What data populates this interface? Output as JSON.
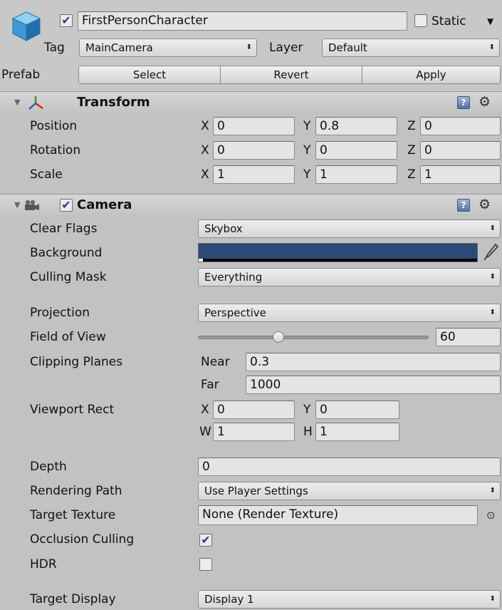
{
  "gameobject": {
    "name": "FirstPersonCharacter",
    "active": true,
    "static_label": "Static",
    "tag_label": "Tag",
    "tag_value": "MainCamera",
    "layer_label": "Layer",
    "layer_value": "Default",
    "prefab_label": "Prefab",
    "prefab_buttons": [
      "Select",
      "Revert",
      "Apply"
    ]
  },
  "transform": {
    "title": "Transform",
    "rows": [
      {
        "label": "Position",
        "x": "0",
        "y": "0.8",
        "z": "0"
      },
      {
        "label": "Rotation",
        "x": "0",
        "y": "0",
        "z": "0"
      },
      {
        "label": "Scale",
        "x": "1",
        "y": "1",
        "z": "1"
      }
    ],
    "axis_labels": [
      "X",
      "Y",
      "Z"
    ]
  },
  "camera": {
    "title": "Camera",
    "enabled": true,
    "clear_flags": {
      "label": "Clear Flags",
      "value": "Skybox"
    },
    "background": {
      "label": "Background",
      "color": "#2c4a78"
    },
    "culling_mask": {
      "label": "Culling Mask",
      "value": "Everything"
    },
    "projection": {
      "label": "Projection",
      "value": "Perspective"
    },
    "field_of_view": {
      "label": "Field of View",
      "value": "60",
      "slider_fraction": 0.34
    },
    "clipping_planes": {
      "label": "Clipping Planes",
      "near_label": "Near",
      "near": "0.3",
      "far_label": "Far",
      "far": "1000"
    },
    "viewport_rect": {
      "label": "Viewport Rect",
      "x_label": "X",
      "x": "0",
      "y_label": "Y",
      "y": "0",
      "w_label": "W",
      "w": "1",
      "h_label": "H",
      "h": "1"
    },
    "depth": {
      "label": "Depth",
      "value": "0"
    },
    "rendering_path": {
      "label": "Rendering Path",
      "value": "Use Player Settings"
    },
    "target_texture": {
      "label": "Target Texture",
      "value": "None (Render Texture)"
    },
    "occlusion_culling": {
      "label": "Occlusion Culling",
      "checked": true
    },
    "hdr": {
      "label": "HDR",
      "checked": false
    },
    "target_display": {
      "label": "Target Display",
      "value": "Display 1"
    }
  },
  "icons": {
    "gameobject": "cube-icon",
    "transform": "transform-axes-icon",
    "camera": "camera-icon",
    "help": "help-book-icon",
    "settings": "gear-icon",
    "eyedropper": "eyedropper-icon",
    "object_picker": "object-picker-icon"
  }
}
